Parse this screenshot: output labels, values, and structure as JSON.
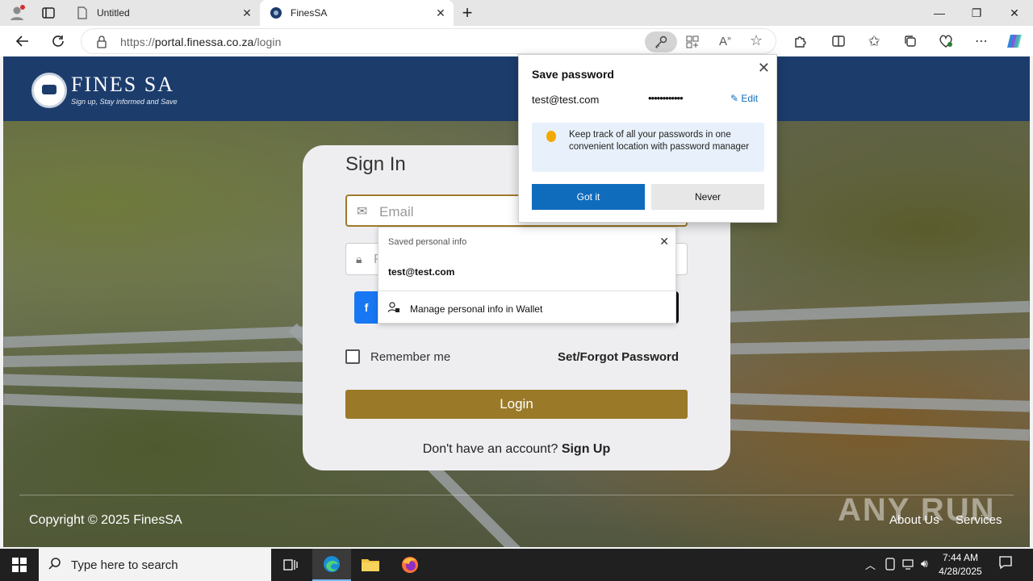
{
  "browser": {
    "tabs": [
      {
        "title": "Untitled"
      },
      {
        "title": "FinesSA"
      }
    ],
    "new_tab_symbol": "+",
    "address": {
      "scheme": "https://",
      "host": "portal.finessa.co.za",
      "path": "/login"
    },
    "icons": [
      "profile-icon",
      "tab-actions-icon",
      "back-icon",
      "refresh-icon",
      "lock-icon",
      "key-icon",
      "app-available-icon",
      "read-aloud-icon",
      "favorite-icon",
      "extensions-icon",
      "split-screen-icon",
      "favorites-icon",
      "collections-icon",
      "performance-icon",
      "more-icon",
      "copilot-icon"
    ],
    "accent": "#0f6cbd"
  },
  "site": {
    "brand": "FINES SA",
    "tagline": "Sign up, Stay informed and Save",
    "header_color": "#1c3c6c",
    "signin": {
      "title": "Sign In",
      "email_placeholder": "Email",
      "password_placeholder": "P",
      "facebook_letter": "f",
      "remember_label": "Remember me",
      "forgot_label": "Set/Forgot Password",
      "login_label": "Login",
      "signup_prompt": "Don't have an account?",
      "signup_link": "Sign Up"
    },
    "footer": {
      "copyright": "Copyright © 2025 FinesSA",
      "links": [
        "About Us",
        "Services"
      ]
    },
    "button_color": "#9a7a28"
  },
  "autofill": {
    "header": "Saved personal info",
    "item": "test@test.com",
    "manage_label": "Manage personal info in Wallet"
  },
  "save_password": {
    "title": "Save password",
    "username": "test@test.com",
    "password_mask": "••••••••••••",
    "edit_label": "Edit",
    "tip": "Keep track of all your passwords in one convenient location with password manager",
    "primary_label": "Got it",
    "secondary_label": "Never"
  },
  "watermark": "ANY RUN",
  "taskbar": {
    "search_placeholder": "Type here to search",
    "time": "7:44 AM",
    "date": "4/28/2025"
  }
}
